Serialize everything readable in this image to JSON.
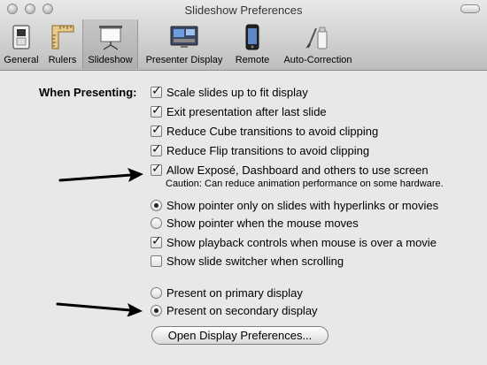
{
  "window": {
    "title": "Slideshow Preferences"
  },
  "toolbar": {
    "items": [
      {
        "label": "General",
        "icon": "general-switch-icon"
      },
      {
        "label": "Rulers",
        "icon": "rulers-icon"
      },
      {
        "label": "Slideshow",
        "icon": "projector-screen-icon",
        "selected": true
      },
      {
        "label": "Presenter Display",
        "icon": "presenter-display-icon"
      },
      {
        "label": "Remote",
        "icon": "iphone-icon"
      },
      {
        "label": "Auto-Correction",
        "icon": "auto-correction-icon"
      }
    ]
  },
  "presenting": {
    "section_label": "When Presenting:",
    "options": [
      {
        "label": "Scale slides up to fit display",
        "checked": true
      },
      {
        "label": "Exit presentation after last slide",
        "checked": true
      },
      {
        "label": "Reduce Cube transitions to avoid clipping",
        "checked": true
      },
      {
        "label": "Reduce Flip transitions to avoid clipping",
        "checked": true
      },
      {
        "label": "Allow Exposé, Dashboard and others to use screen",
        "checked": true
      }
    ],
    "caution": "Caution: Can reduce animation performance on some hardware."
  },
  "pointer": {
    "options": [
      {
        "label": "Show pointer only on slides with hyperlinks or movies",
        "selected": true
      },
      {
        "label": "Show pointer when the mouse moves",
        "selected": false
      }
    ]
  },
  "movie": {
    "options": [
      {
        "label": "Show playback controls when mouse is over a movie",
        "checked": true
      },
      {
        "label": "Show slide switcher when scrolling",
        "checked": false
      }
    ]
  },
  "display": {
    "options": [
      {
        "label": "Present on primary display",
        "selected": false
      },
      {
        "label": "Present on secondary display",
        "selected": true
      }
    ],
    "button_label": "Open Display Preferences..."
  }
}
